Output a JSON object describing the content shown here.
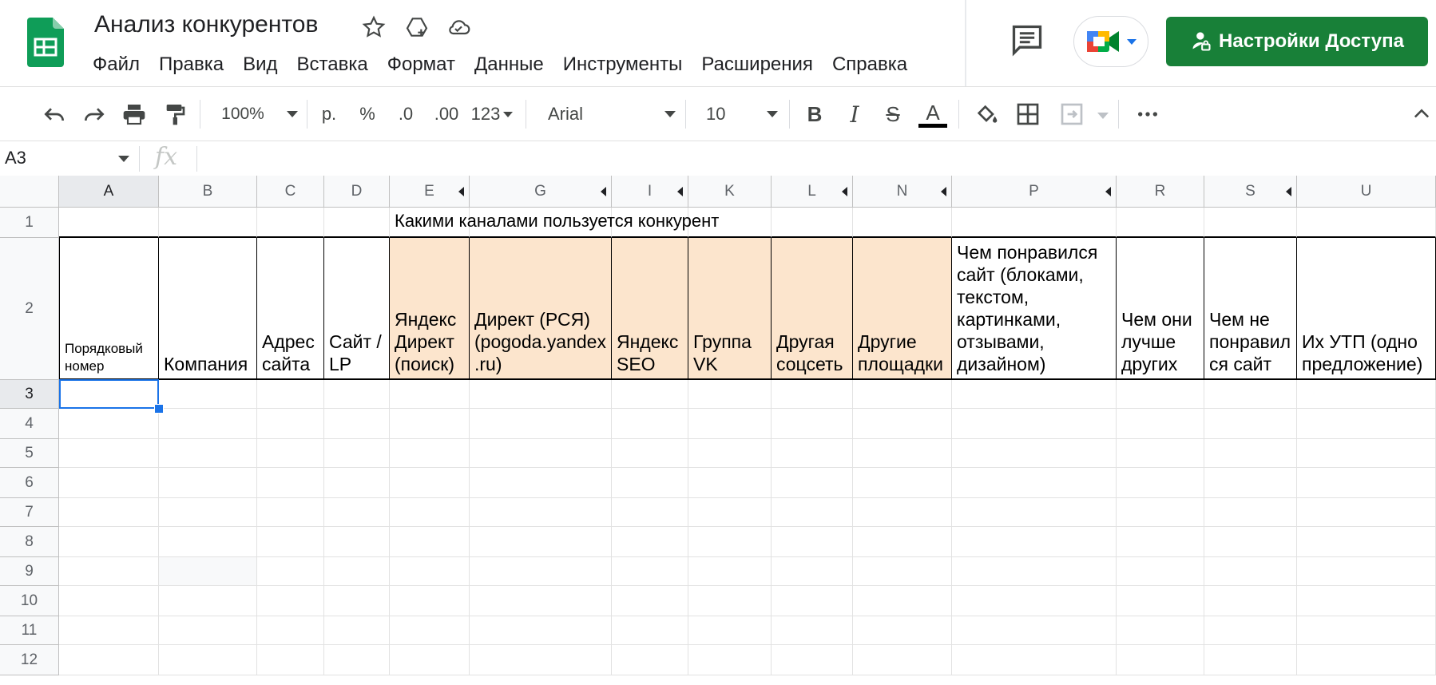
{
  "header": {
    "title": "Анализ конкурентов",
    "menu": [
      "Файл",
      "Правка",
      "Вид",
      "Вставка",
      "Формат",
      "Данные",
      "Инструменты",
      "Расширения",
      "Справка"
    ],
    "share_label": "Настройки Доступа"
  },
  "toolbar": {
    "zoom": "100%",
    "currency": "р.",
    "percent": "%",
    "dec_decrease": ".0",
    "dec_increase": ".00",
    "format_more": "123",
    "font": "Arial",
    "font_size": "10",
    "bold": "B",
    "italic": "I",
    "strike": "S",
    "text_color": "A"
  },
  "formula_bar": {
    "cell_ref": "A3",
    "fx": "fx"
  },
  "grid": {
    "columns": [
      "A",
      "B",
      "C",
      "D",
      "E",
      "G",
      "I",
      "K",
      "L",
      "N",
      "P",
      "R",
      "S",
      "U"
    ],
    "rows": [
      "1",
      "2",
      "3",
      "4",
      "5",
      "6",
      "7",
      "8",
      "9",
      "10",
      "11",
      "12"
    ],
    "row1_merged_text": "Какими каналами пользуется конкурент",
    "headers": {
      "A": "Порядковый номер",
      "B": "Компания",
      "C": "Адрес сайта",
      "D": "Сайт / LP",
      "E": "Яндекс Директ (поиск)",
      "G": "Директ (РСЯ) (pogoda.yandex.ru)",
      "I": "Яндекс SEO",
      "K": "Группа VK",
      "L": "Другая соцсеть",
      "N": "Другие площадки",
      "P": "Чем понравился сайт (блоками, текстом, картинками, отзывами, дизайном)",
      "R": "Чем они лучше других",
      "S": "Чем не понравился сайт",
      "U": "Их УТП (одно предложение)"
    },
    "header_fill": "#fce5cd",
    "selection_color": "#1a73e8"
  }
}
